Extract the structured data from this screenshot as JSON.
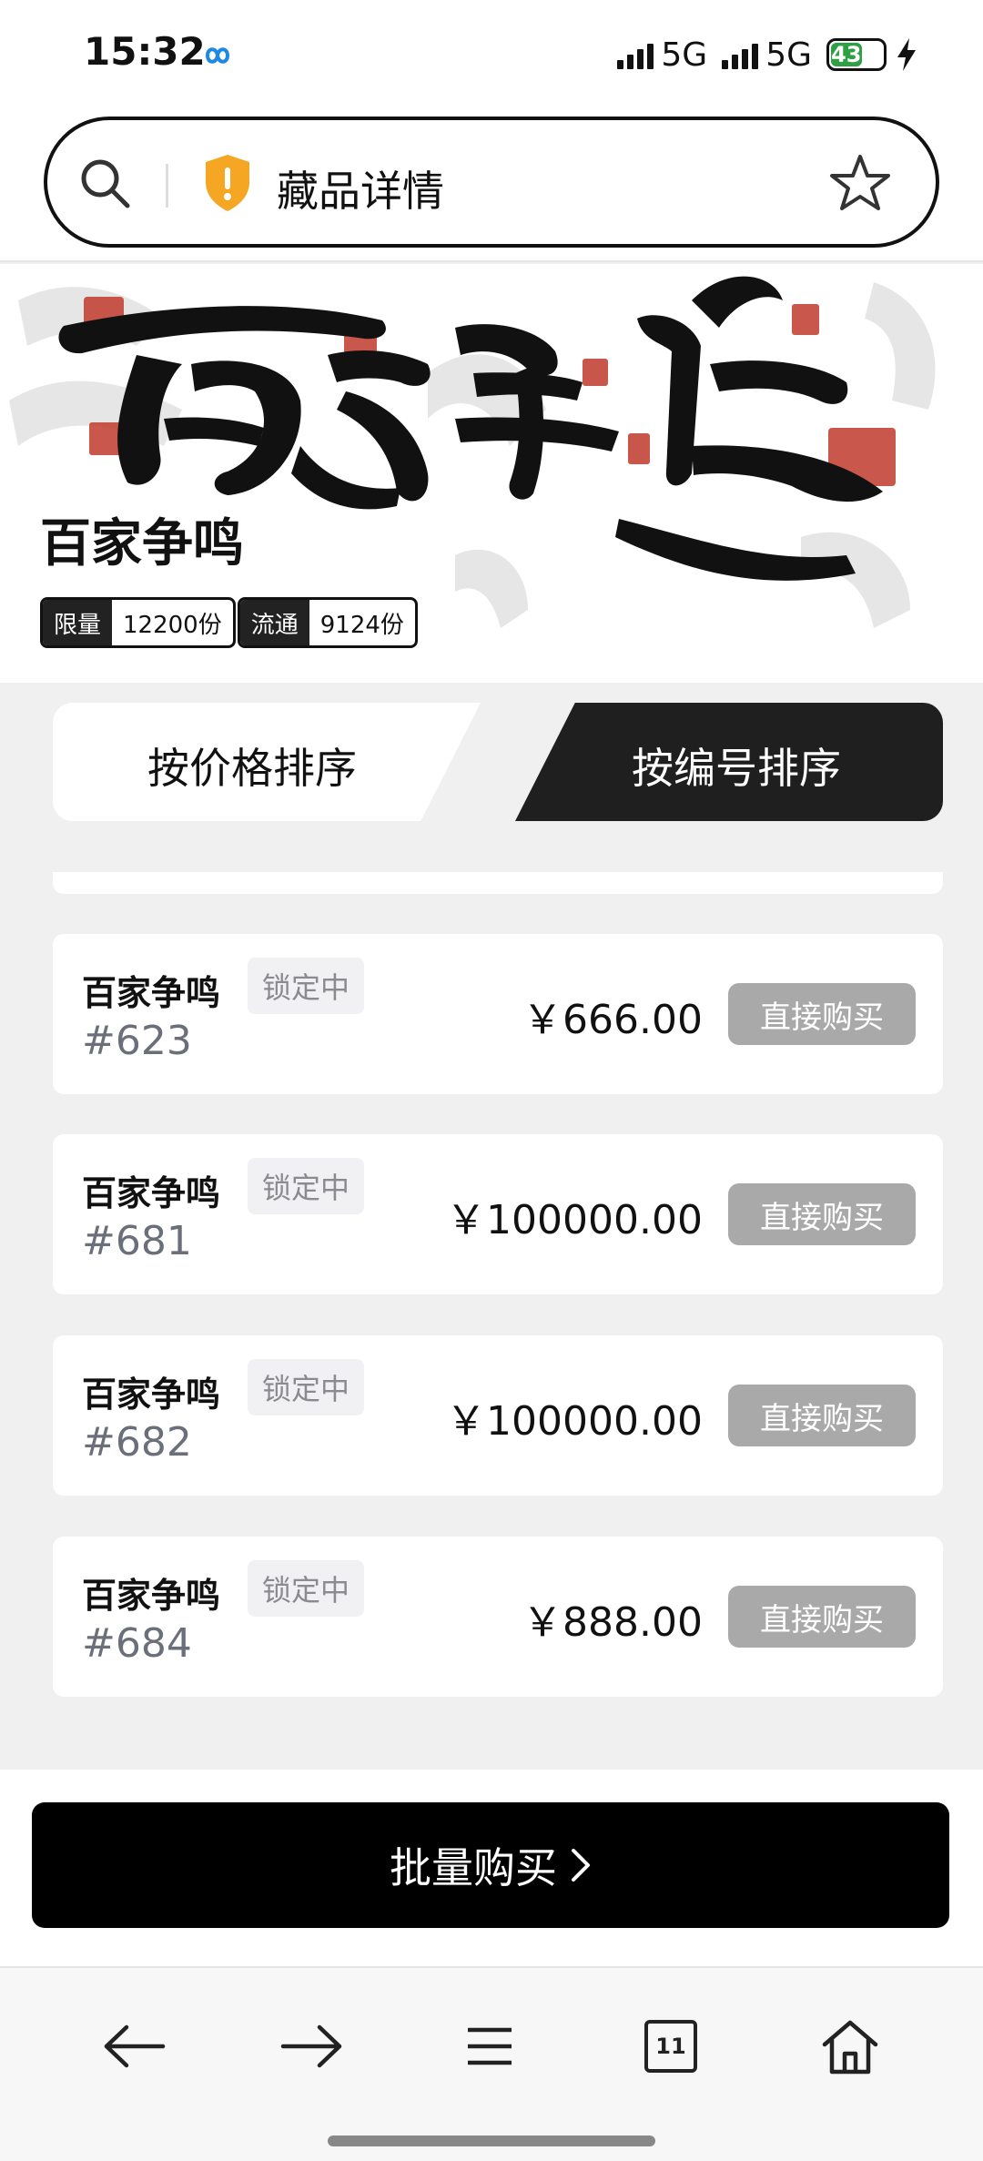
{
  "status_bar": {
    "time": "15:32",
    "network1": "5G",
    "network2": "5G",
    "battery": "43",
    "battery_level_percent": 43
  },
  "browser": {
    "page_title": "藏品详情"
  },
  "collection": {
    "title": "百家争鸣",
    "limit_label": "限量",
    "limit_value": "12200份",
    "circulation_label": "流通",
    "circulation_value": "9124份"
  },
  "sort_tabs": {
    "by_price": "按价格排序",
    "by_number": "按编号排序",
    "active": "by_number"
  },
  "listings": [
    {
      "name": "百家争鸣",
      "status": "锁定中",
      "number": "#623",
      "price": "￥666.00",
      "action": "直接购买"
    },
    {
      "name": "百家争鸣",
      "status": "锁定中",
      "number": "#681",
      "price": "￥100000.00",
      "action": "直接购买"
    },
    {
      "name": "百家争鸣",
      "status": "锁定中",
      "number": "#682",
      "price": "￥100000.00",
      "action": "直接购买"
    },
    {
      "name": "百家争鸣",
      "status": "锁定中",
      "number": "#684",
      "price": "￥888.00",
      "action": "直接购买"
    }
  ],
  "bulk_buy": {
    "label": "批量购买"
  },
  "bottom_nav": {
    "tab_count": "11",
    "icons": [
      "back-icon",
      "forward-icon",
      "menu-icon",
      "tabs-icon",
      "home-icon"
    ]
  },
  "colors": {
    "accent_dark": "#1f1f1f",
    "disabled_button": "#a9a9a9",
    "battery_green": "#2ea043",
    "shield_yellow": "#f5a623"
  }
}
